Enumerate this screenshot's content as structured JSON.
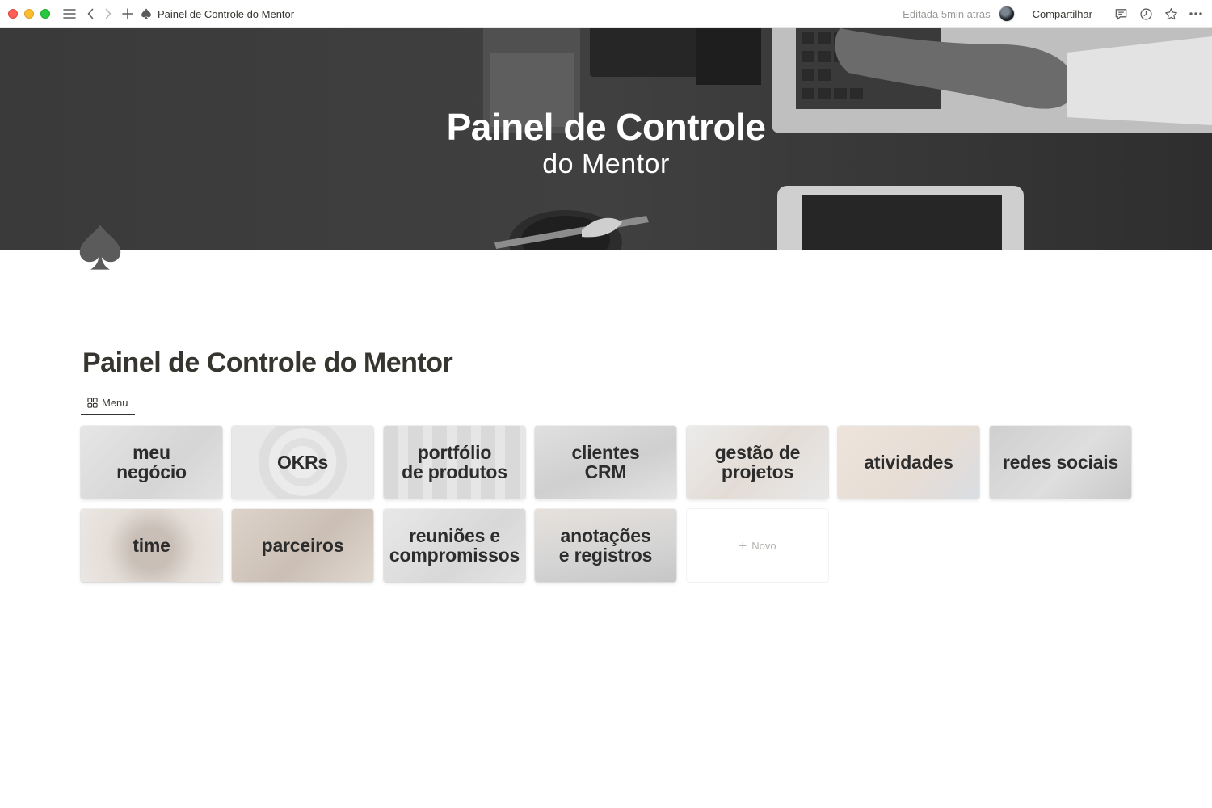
{
  "titlebar": {
    "page_title": "Painel de Controle do Mentor",
    "edited": "Editada 5min atrás",
    "share_label": "Compartilhar",
    "icons": [
      "sidebar-menu-icon",
      "back-arrow-icon",
      "forward-arrow-icon",
      "plus-icon",
      "spade-icon",
      "comment-icon",
      "clock-icon",
      "star-icon",
      "more-icon"
    ]
  },
  "cover": {
    "title": "Painel de Controle",
    "subtitle": "do Mentor"
  },
  "page": {
    "icon": "spade-icon",
    "title": "Painel de Controle do Mentor"
  },
  "views": [
    {
      "label": "Menu",
      "icon": "gallery-icon",
      "active": true
    }
  ],
  "gallery": {
    "cards": [
      {
        "label": "meu\nnegócio"
      },
      {
        "label": "OKRs"
      },
      {
        "label": "portfólio\nde produtos"
      },
      {
        "label": "clientes\nCRM"
      },
      {
        "label": "gestão de\nprojetos"
      },
      {
        "label": "atividades"
      },
      {
        "label": "redes sociais"
      },
      {
        "label": "time"
      },
      {
        "label": "parceiros"
      },
      {
        "label": "reuniões e\ncompromissos"
      },
      {
        "label": "anotações\ne registros"
      }
    ],
    "new_label": "Novo"
  },
  "colors": {
    "text": "#37352f",
    "muted": "#9b9a97",
    "cover_dark": "#3d3d3d"
  }
}
